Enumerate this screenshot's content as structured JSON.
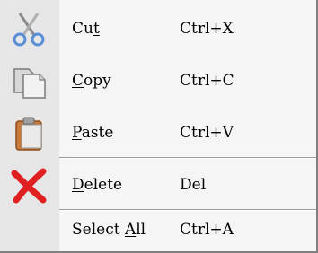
{
  "menu": {
    "items": [
      {
        "label": "Cut",
        "mnemonic_index": 2,
        "shortcut": "Ctrl+X",
        "icon": "scissors-icon"
      },
      {
        "label": "Copy",
        "mnemonic_index": 0,
        "shortcut": "Ctrl+C",
        "icon": "copy-icon"
      },
      {
        "label": "Paste",
        "mnemonic_index": 0,
        "shortcut": "Ctrl+V",
        "icon": "clipboard-icon"
      },
      {
        "label": "Delete",
        "mnemonic_index": 0,
        "shortcut": "Del",
        "icon": "delete-x-icon"
      },
      {
        "label": "Select All",
        "mnemonic_index": 7,
        "shortcut": "Ctrl+A",
        "icon": ""
      }
    ],
    "colors": {
      "background": "#f5f5f5",
      "gutter": "#e6e6e6",
      "scissors": "#5a8fd8",
      "delete": "#e02020"
    }
  }
}
